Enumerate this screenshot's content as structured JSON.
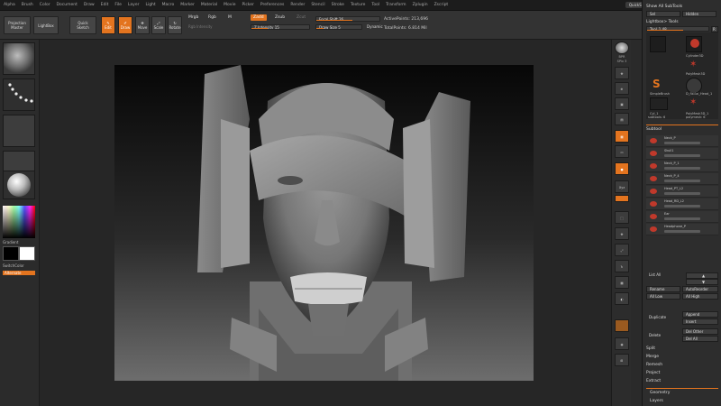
{
  "menu": {
    "items": [
      "Alpha",
      "Brush",
      "Color",
      "Document",
      "Draw",
      "Edit",
      "File",
      "Layer",
      "Light",
      "Macro",
      "Marker",
      "Material",
      "Movie",
      "Picker",
      "Preferences",
      "Render",
      "Stencil",
      "Stroke",
      "Texture",
      "Tool",
      "Transform",
      "Zplugin",
      "Zscript"
    ],
    "quicksave": "QuickSave",
    "default_script": "DefaultZScript"
  },
  "toolbar": {
    "projection_master": "Projection Master",
    "lightbox": "LightBox",
    "quick_sketch": "Quick Sketch",
    "edit": "Edit",
    "draw": "Draw",
    "move": "Move",
    "scale": "Scale",
    "rotate": "Rotate",
    "mrgb": "Mrgb",
    "rgb": "Rgb",
    "m": "M",
    "rgb_intensity": "Rgb Intensity",
    "zadd": "Zadd",
    "zsub": "Zsub",
    "zcut": "Zcut",
    "z_intensity": "Z Intensity 15",
    "focal_shift": "Focal Shift 26",
    "draw_size": "Draw Size 5",
    "dynamic": "Dynamic",
    "active_points": "ActivePoints: 213,696",
    "total_points": "TotalPoints: 6.814 Mil"
  },
  "left_panel": {
    "gradient": "Gradient",
    "switch_color": "SwitchColor",
    "alternate": "Alternate"
  },
  "right_tools": {
    "bpr": "BPR",
    "spix": "SPix 3",
    "scroll": "Scroll",
    "zoom": "Zoom",
    "actual": "Actual",
    "aahalf": "AAHalf",
    "persp": "Persp",
    "floor": "Floor",
    "local": "Local",
    "xyz": "Xyz",
    "frame": "Frame",
    "move": "Move",
    "scale": "Scale",
    "rotate": "Rotate",
    "polyf": "PolyF",
    "transp": "Transp",
    "ghost": "Ghost",
    "solo": "Solo",
    "xpose": "Xpose"
  },
  "right_panel": {
    "show_all": "Show All SubTools",
    "sel": "Sel",
    "hidden": "Hidden",
    "lightbox_tools": "Lightbox> Tools",
    "tool_value": "Tool_1.48",
    "r": "R",
    "thumbs": [
      "Cylinder3D",
      "PolyMesh3D",
      "SimpleBrush",
      "D_Facial_Head_1",
      "Cyl_1",
      "PolyMesh3D_1"
    ],
    "count_left": "subtools: 6",
    "count_right": "polymesh: 6",
    "subtool_header": "Subtool",
    "subtools": [
      "Neck_P",
      "Skull1",
      "Neck_P_1",
      "Neck_P_4",
      "Head_PT_L2",
      "Head_RD_L2",
      "Ear",
      "Headphone_P"
    ],
    "list_all": "List All",
    "rename": "Rename",
    "auto_reorder": "AutoReorder",
    "all_low": "All Low",
    "all_high": "All High",
    "duplicate": "Duplicate",
    "append": "Append",
    "insert": "Insert",
    "delete": "Delete",
    "del_other": "Del Other",
    "del_all": "Del All",
    "split": "Split",
    "merge": "Merge",
    "remesh": "Remesh",
    "project": "Project",
    "extract": "Extract",
    "geometry": "Geometry",
    "layers": "Layers"
  },
  "colors": {
    "accent": "#e3741f",
    "panel": "#2d2d2d",
    "background": "#262626"
  }
}
